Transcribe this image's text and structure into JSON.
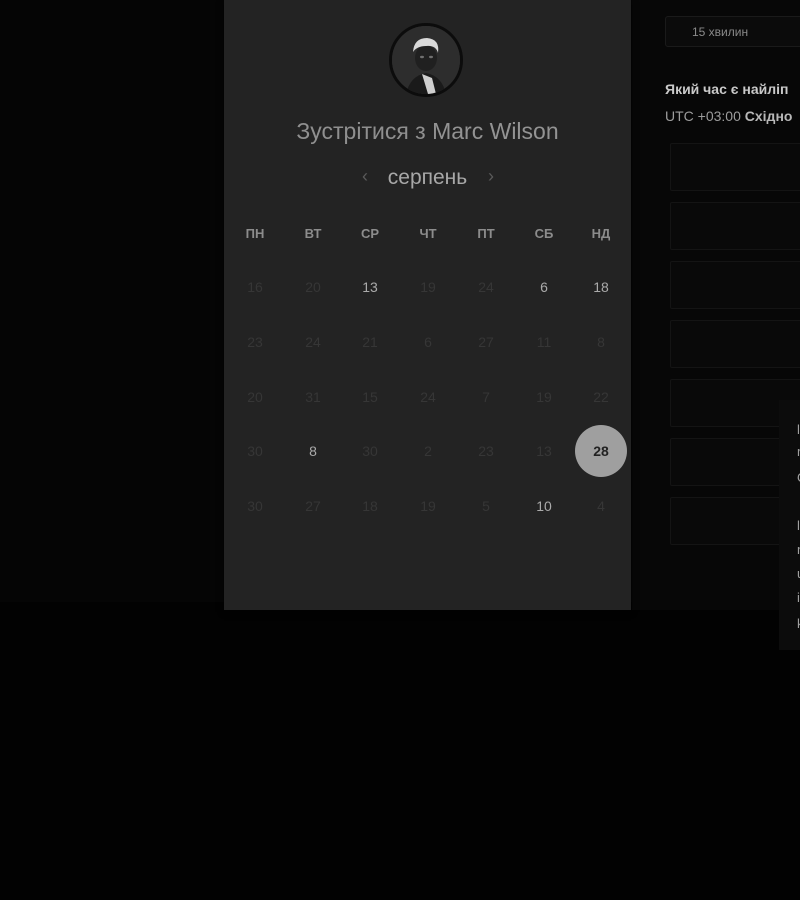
{
  "right_panel": {
    "duration": "15 хвилин",
    "question": "Який час є найліп",
    "timezone_offset": "UTC +03:00",
    "timezone_name": "Східно",
    "popup_letters": [
      "l",
      "m",
      "G",
      "l",
      "n",
      "u",
      "i",
      "k"
    ]
  },
  "calendar": {
    "title_prefix": "Зустрітися з",
    "host_name": "Marc Wilson",
    "month": "серпень",
    "prev_icon": "chevron-left-icon",
    "next_icon": "chevron-right-icon",
    "weekdays": [
      "ПН",
      "ВТ",
      "СР",
      "ЧТ",
      "ПТ",
      "СБ",
      "НД"
    ],
    "weeks": [
      [
        {
          "t": "16",
          "a": false
        },
        {
          "t": "20",
          "a": false
        },
        {
          "t": "13",
          "a": true
        },
        {
          "t": "19",
          "a": false
        },
        {
          "t": "24",
          "a": false
        },
        {
          "t": "6",
          "a": true
        },
        {
          "t": "18",
          "a": true
        }
      ],
      [
        {
          "t": "23",
          "a": false
        },
        {
          "t": "24",
          "a": false
        },
        {
          "t": "21",
          "a": false
        },
        {
          "t": "6",
          "a": false
        },
        {
          "t": "27",
          "a": false
        },
        {
          "t": "11",
          "a": false
        },
        {
          "t": "8",
          "a": false
        }
      ],
      [
        {
          "t": "20",
          "a": false
        },
        {
          "t": "31",
          "a": false
        },
        {
          "t": "15",
          "a": false
        },
        {
          "t": "24",
          "a": false
        },
        {
          "t": "7",
          "a": false
        },
        {
          "t": "19",
          "a": false
        },
        {
          "t": "22",
          "a": false
        }
      ],
      [
        {
          "t": "30",
          "a": false
        },
        {
          "t": "8",
          "a": true
        },
        {
          "t": "30",
          "a": false
        },
        {
          "t": "2",
          "a": false
        },
        {
          "t": "23",
          "a": false
        },
        {
          "t": "13",
          "a": false
        },
        {
          "t": "28",
          "a": true,
          "selected": true
        }
      ],
      [
        {
          "t": "30",
          "a": false
        },
        {
          "t": "27",
          "a": false
        },
        {
          "t": "18",
          "a": false
        },
        {
          "t": "19",
          "a": false
        },
        {
          "t": "5",
          "a": false
        },
        {
          "t": "10",
          "a": true
        },
        {
          "t": "4",
          "a": false
        }
      ]
    ]
  }
}
